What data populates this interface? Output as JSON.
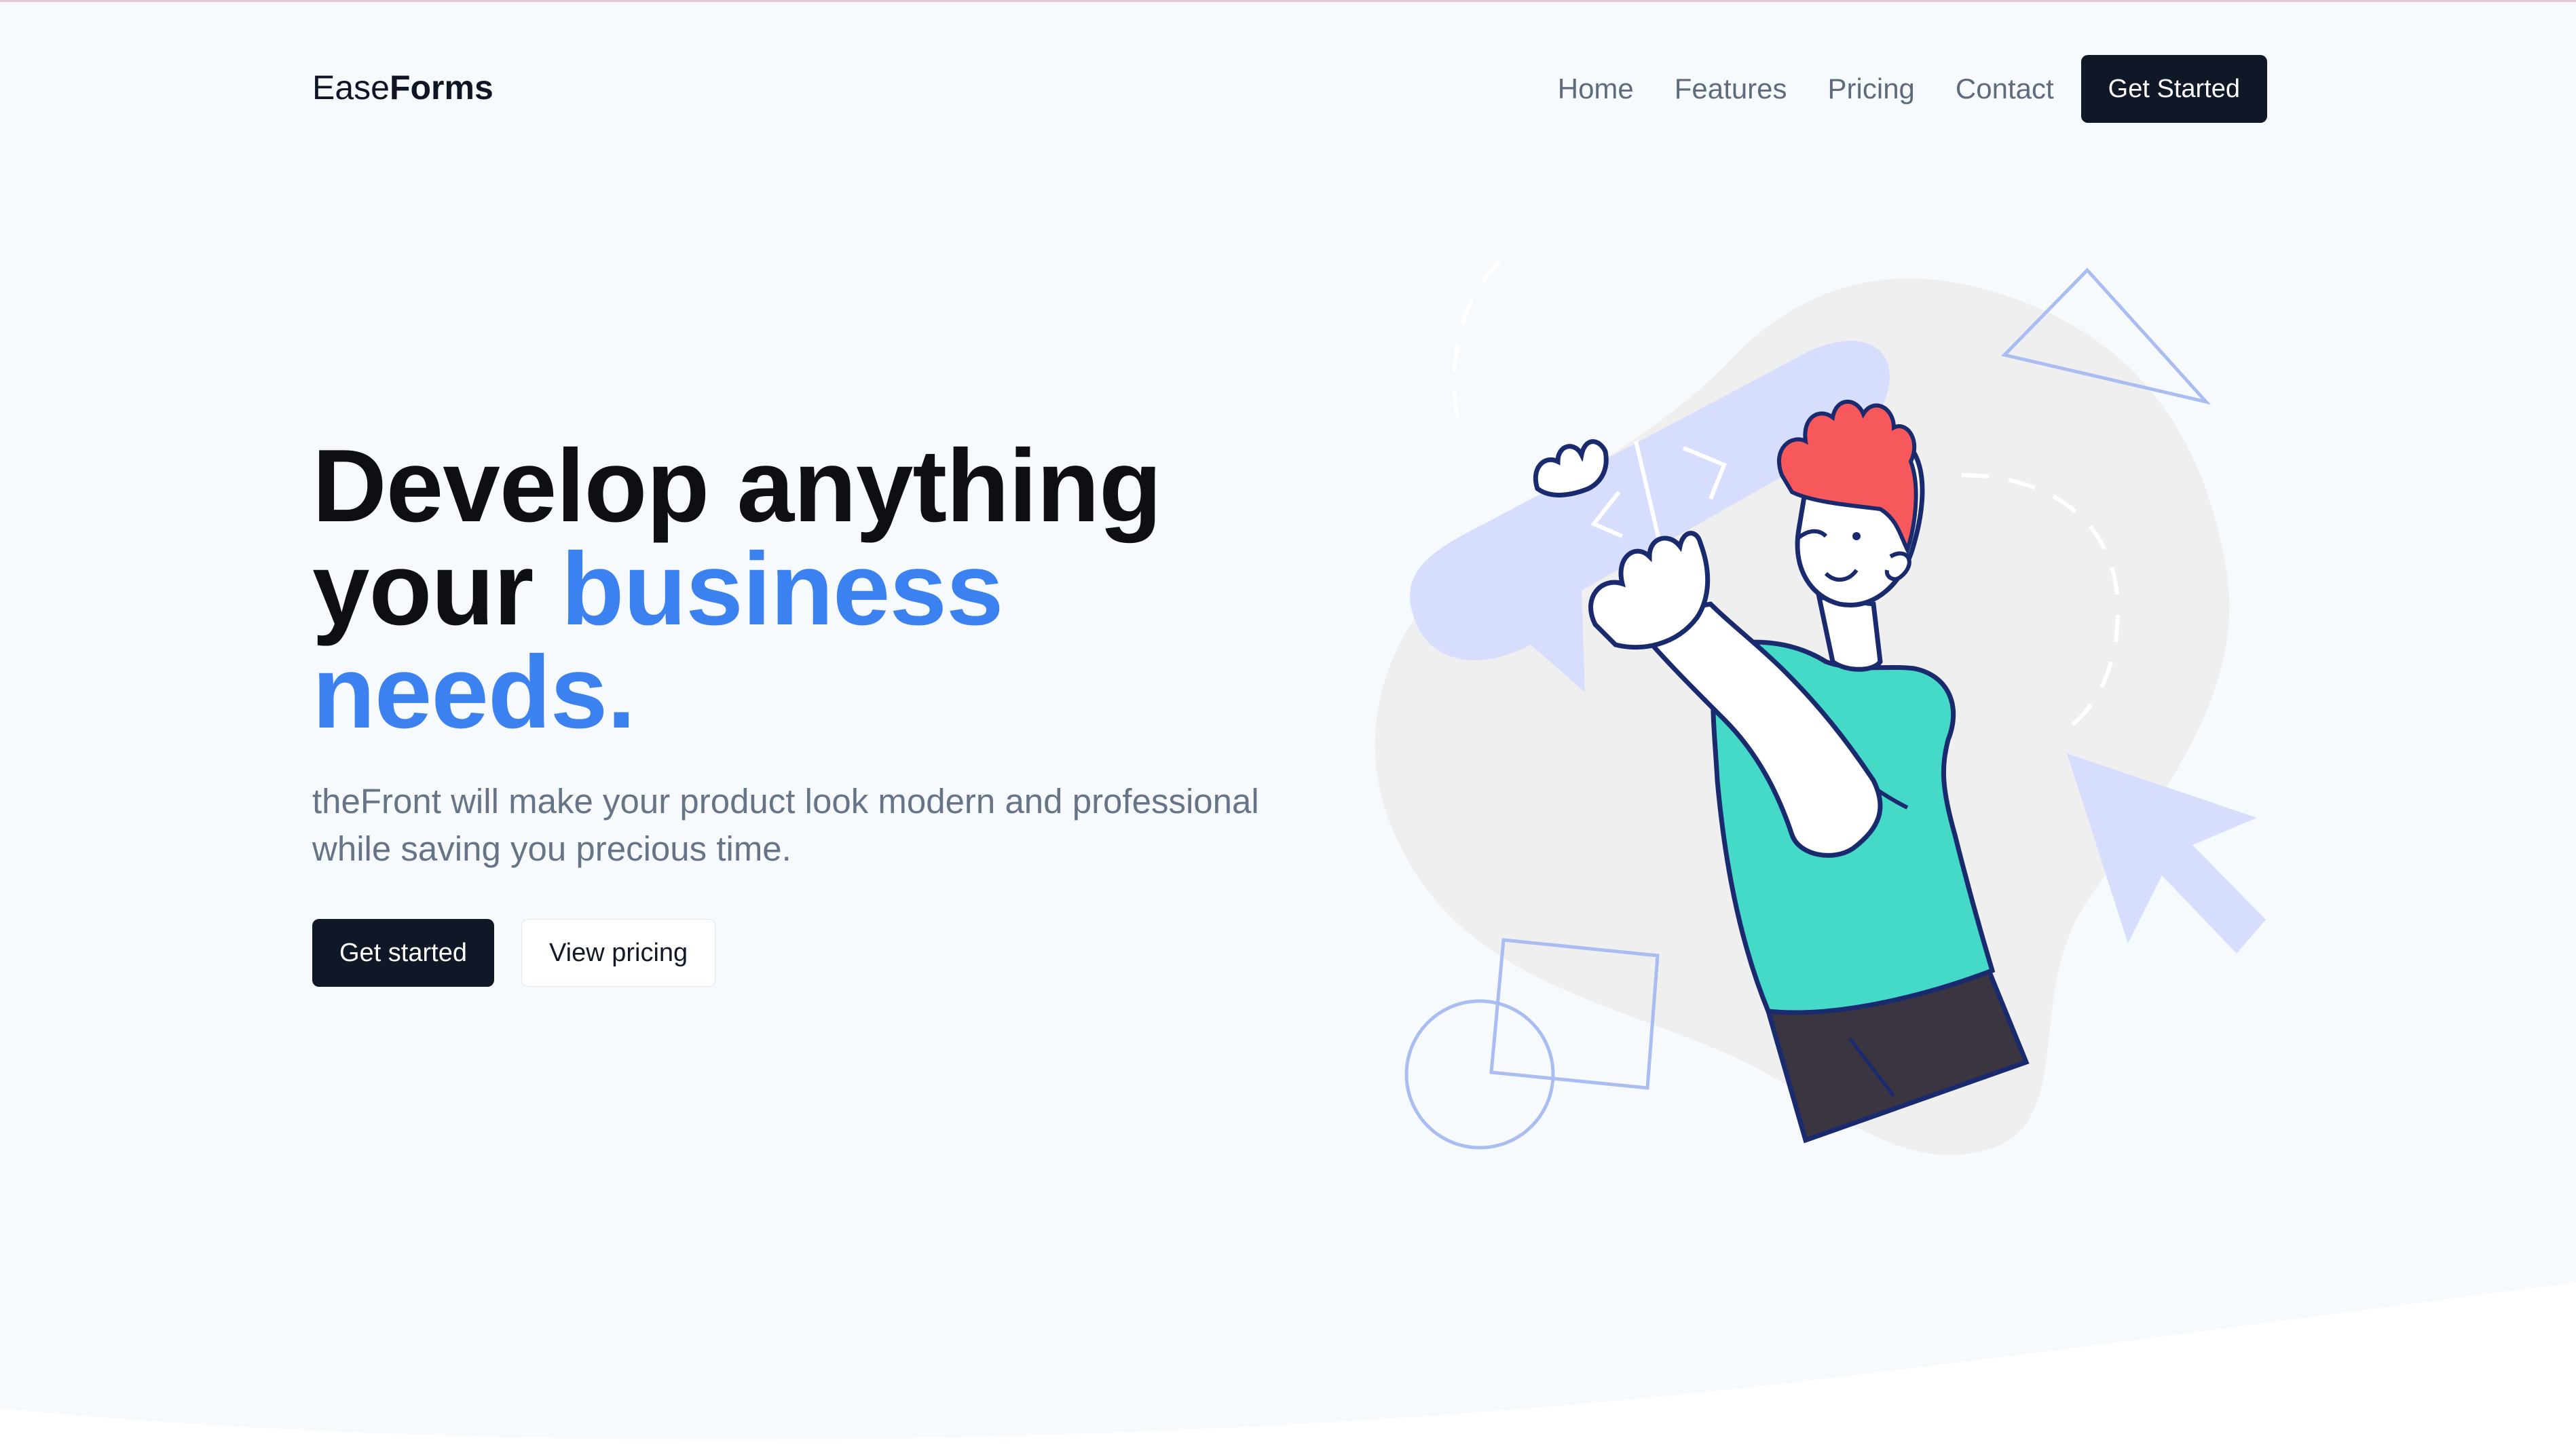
{
  "header": {
    "logo_light": "Ease",
    "logo_bold": "Forms",
    "nav": [
      {
        "label": "Home"
      },
      {
        "label": "Features"
      },
      {
        "label": "Pricing"
      },
      {
        "label": "Contact"
      }
    ],
    "cta_label": "Get Started"
  },
  "hero": {
    "headline_line1": "Develop anything",
    "headline_line2_plain": "your ",
    "headline_line2_accent": "business",
    "headline_line3_accent": "needs.",
    "subtext": "theFront will make your product look modern and professional while saving you precious time.",
    "primary_button": "Get started",
    "secondary_button": "View pricing"
  },
  "colors": {
    "accent": "#3b82f0",
    "dark": "#101828",
    "muted_text": "#677488",
    "background": "#f7fafd",
    "shirt": "#45d9c7",
    "hair": "#f7585c",
    "outline": "#1a2a6e",
    "bubble": "#d7defd"
  },
  "icons": [
    "code-bubble-icon",
    "cursor-arrow-icon",
    "triangle-outline-icon",
    "square-outline-icon",
    "circle-outline-icon"
  ]
}
